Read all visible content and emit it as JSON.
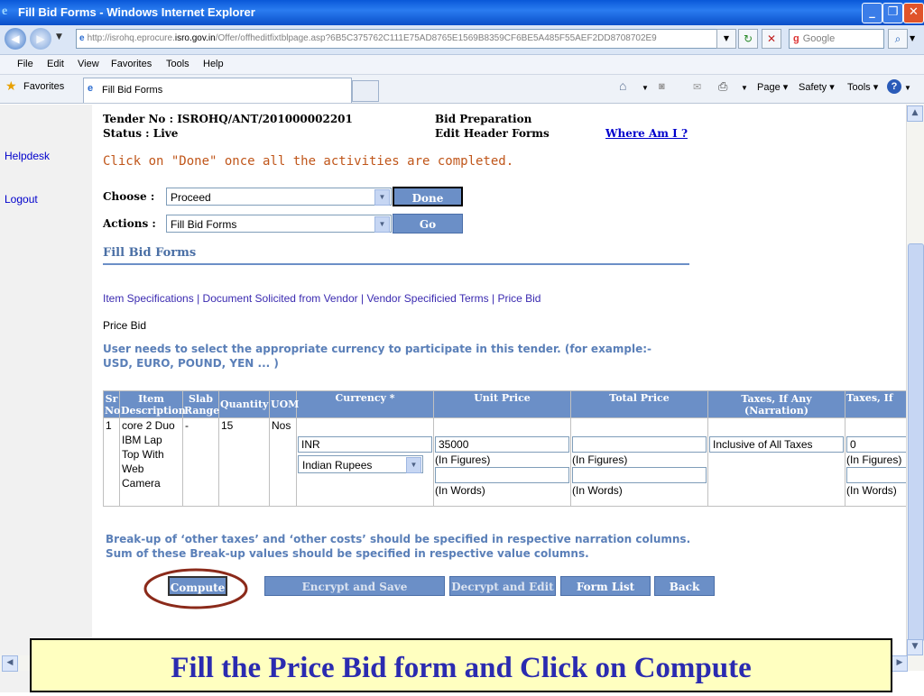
{
  "window": {
    "title": "Fill Bid Forms - Windows Internet Explorer"
  },
  "addressbar": {
    "url_prefix": "http://isrohq.eprocure.",
    "url_domain": "isro.gov.in",
    "url_rest": "/Offer/offheditfixtblpage.asp?6B5C375762C111E75AD8765E1569B8359CF6BE5A485F55AEF2DD8708702E9",
    "search_placeholder": "Google"
  },
  "menu": [
    "File",
    "Edit",
    "View",
    "Favorites",
    "Tools",
    "Help"
  ],
  "favorites_bar": {
    "favorites_label": "Favorites",
    "tab_title": "Fill Bid Forms",
    "tools": [
      "Page",
      "Safety",
      "Tools"
    ]
  },
  "sidebar": {
    "items": [
      "Helpdesk",
      "Logout"
    ]
  },
  "header": {
    "tender_no": "Tender No : ISROHQ/ANT/201000002201",
    "status": "Status : Live",
    "stage": "Bid Preparation",
    "substage": "Edit Header Forms",
    "where_link": "Where Am I ?",
    "instruction": "Click on \"Done\" once all the activities are completed."
  },
  "controls": {
    "choose_label": "Choose :",
    "choose_value": "Proceed",
    "done_button": "Done",
    "actions_label": "Actions :",
    "actions_value": "Fill Bid Forms",
    "go_button": "Go"
  },
  "section": {
    "title": "Fill Bid Forms",
    "form_links": [
      "Item Specifications",
      "Document Solicited from Vendor",
      "Vendor Specificied Terms",
      "Price Bid"
    ],
    "separator": "|",
    "current_form": "Price Bid",
    "note": "User needs to select the appropriate currency to participate in this tender. (for example:- USD, EURO, POUND, YEN ... )"
  },
  "table": {
    "headers": [
      "Sr No",
      "Item Description",
      "Slab Range",
      "Quantity",
      "UOM",
      "Currency *",
      "Unit Price",
      "Total Price",
      "Taxes, If Any (Narration)",
      "Taxes, If"
    ],
    "row": {
      "sr": "1",
      "description": "core 2 Duo IBM Lap Top With Web Camera",
      "slab": "-",
      "quantity": "15",
      "uom": "Nos",
      "currency_code": "INR",
      "currency_select": "Indian Rupees",
      "unit_price": "35000",
      "total_price": "",
      "tax_narration": "Inclusive of All Taxes",
      "tax_value": "0",
      "in_figures": "(In Figures)",
      "in_words": "(In Words)"
    }
  },
  "footnote": {
    "line1": "Break-up of ‘other taxes’ and ‘other costs’ should be specified in respective narration columns.",
    "line2": "Sum of these Break-up values should be specified in respective value columns."
  },
  "actions": [
    "Compute",
    "Encrypt and Save",
    "Decrypt and Edit",
    "Form List",
    "Back"
  ],
  "banner": "Fill the Price Bid form and Click on Compute",
  "colors": {
    "header_blue": "#6b8fc7",
    "instruction": "#c0561a",
    "highlight_ring": "#8b2a1a",
    "banner_text": "#2b2bb0"
  }
}
